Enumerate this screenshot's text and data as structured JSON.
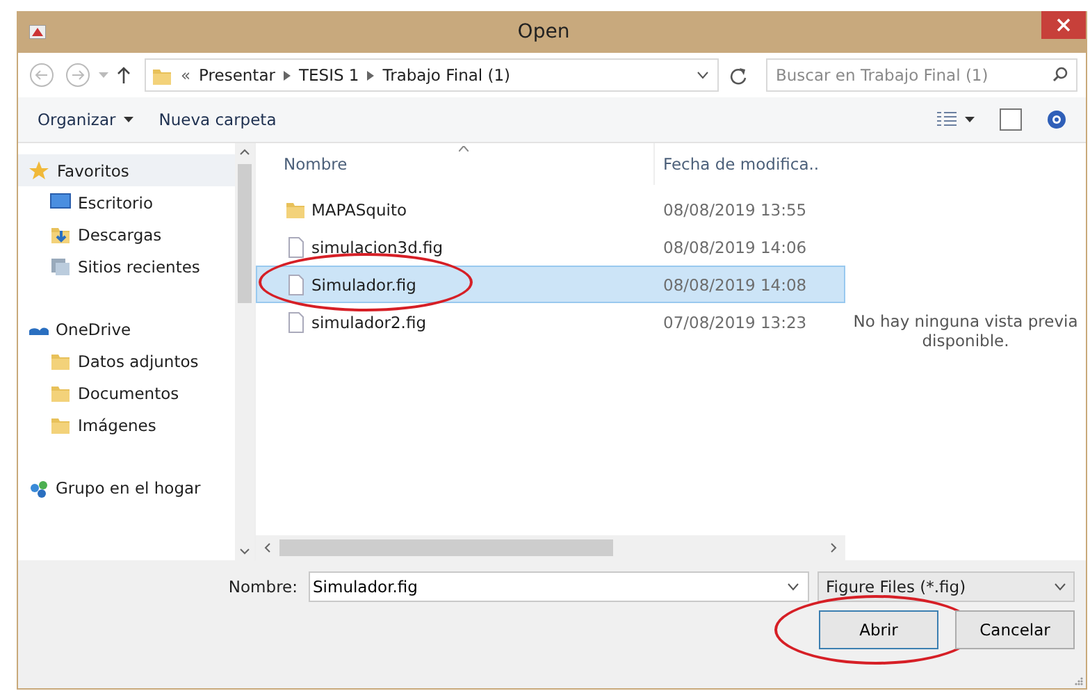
{
  "window": {
    "title": "Open"
  },
  "address": {
    "path": [
      "Presentar",
      "TESIS 1",
      "Trabajo Final (1)"
    ],
    "overflow": "«"
  },
  "search": {
    "placeholder": "Buscar en Trabajo Final (1)"
  },
  "toolbar": {
    "organize": "Organizar",
    "new_folder": "Nueva carpeta"
  },
  "sidebar": {
    "groups": [
      {
        "label": "Favoritos",
        "selected": true,
        "children": [
          {
            "label": "Escritorio",
            "selected": false
          },
          {
            "label": "Descargas",
            "selected": false
          },
          {
            "label": "Sitios recientes",
            "selected": false
          }
        ]
      },
      {
        "label": "OneDrive",
        "selected": false,
        "children": [
          {
            "label": "Datos adjuntos",
            "selected": false
          },
          {
            "label": "Documentos",
            "selected": false
          },
          {
            "label": "Imágenes",
            "selected": false
          }
        ]
      },
      {
        "label": "Grupo en el hogar",
        "selected": false
      }
    ]
  },
  "table": {
    "columns": [
      "Nombre",
      "Fecha de modifica.."
    ],
    "rows": [
      {
        "kind": "folder",
        "name": "MAPASquito",
        "date": "08/08/2019 13:55",
        "selected": false,
        "circled": false
      },
      {
        "kind": "file",
        "name": "simulacion3d.fig",
        "date": "08/08/2019 14:06",
        "selected": false,
        "circled": false
      },
      {
        "kind": "file",
        "name": "Simulador.fig",
        "date": "08/08/2019 14:08",
        "selected": true,
        "circled": true
      },
      {
        "kind": "file",
        "name": "simulador2.fig",
        "date": "07/08/2019 13:23",
        "selected": false,
        "circled": false
      }
    ]
  },
  "preview": {
    "message": "No hay ninguna vista previa disponible."
  },
  "filename": {
    "label": "Nombre:",
    "value": "Simulador.fig"
  },
  "filter": {
    "value": "Figure Files (*.fig)"
  },
  "buttons": [
    {
      "label": "Abrir",
      "circled": true
    },
    {
      "label": "Cancelar",
      "circled": false
    }
  ]
}
